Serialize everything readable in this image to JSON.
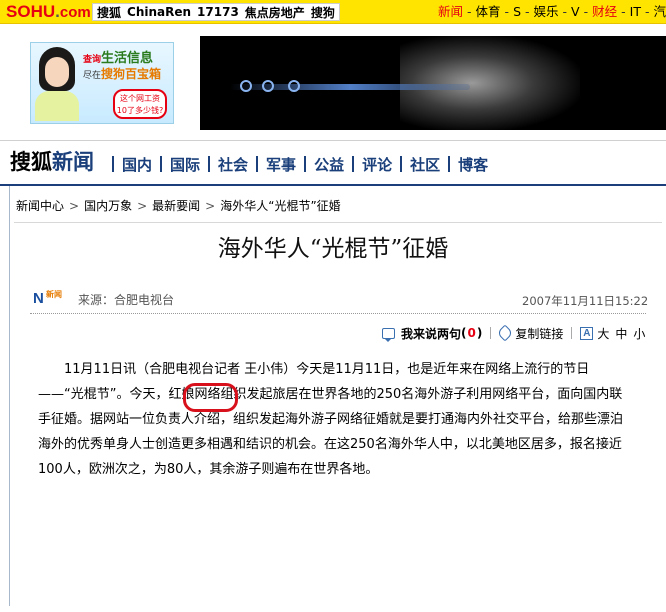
{
  "topbar": {
    "logo": {
      "so": "SO",
      "hu": "HU",
      "dot": ".",
      "com": "com"
    },
    "site_links": [
      "搜狐",
      "ChinaRen",
      "17173",
      "焦点房地产",
      "搜狗"
    ],
    "channels": [
      {
        "label": "新闻",
        "active": true
      },
      {
        "label": "体育",
        "active": false
      },
      {
        "label": "S",
        "active": false
      },
      {
        "label": "娱乐",
        "active": false
      },
      {
        "label": "V",
        "active": false
      },
      {
        "label": "财经",
        "active": true
      },
      {
        "label": "IT",
        "active": false
      },
      {
        "label": "汽车",
        "active": false
      }
    ],
    "channel_separator": "-"
  },
  "ad": {
    "line1_small": "查询",
    "line1": "生活信息",
    "line2_small": "尽在",
    "line2": "搜狗百宝箱",
    "bubble_line1": "这个网工资",
    "bubble_line2": "10了多少钱?"
  },
  "nav": {
    "brand_sohu": "搜狐",
    "brand_news": "新闻",
    "items": [
      "国内",
      "国际",
      "社会",
      "军事",
      "公益",
      "评论",
      "社区",
      "博客"
    ]
  },
  "breadcrumb": {
    "items": [
      "新闻中心",
      "国内万象",
      "最新要闻",
      "海外华人“光棍节”征婚"
    ],
    "separator": ">"
  },
  "article": {
    "title": "海外华人“光棍节”征婚",
    "logo_text": "N",
    "logo_sub": "新闻",
    "source": "来源：合肥电视台",
    "datetime": "2007年11月11日15:22",
    "tools": {
      "comment_label": "我来说两句",
      "comment_open": "(",
      "comment_count": "0",
      "comment_close": ")",
      "copy_link_label": "复制链接",
      "font_icon_letter": "A",
      "font_sizes": [
        "大",
        "中",
        "小"
      ]
    },
    "paragraph": "11月11日讯（合肥电视台记者 王小伟）今天是11月11日，也是近年来在网络上流行的节日——“光棍节”。今天，红娘网络组织发起旅居在世界各地的250名海外游子利用网络平台，面向国内联手征婚。据网站一位负责人介绍，组织发起海外游子网络征婚就是要打通海内外社交平台，给那些漂泊海外的优秀单身人士创造更多相遇和结识的机会。在这250名海外华人中，以北美地区居多，报名接近100人，欧洲次之，为80人，其余游子则遍布在世界各地。"
  },
  "colors": {
    "topbar_yellow": "#ffe400",
    "brand_red": "#e60012",
    "nav_blue": "#1a3f7a",
    "annotation_red": "#d8101c"
  }
}
